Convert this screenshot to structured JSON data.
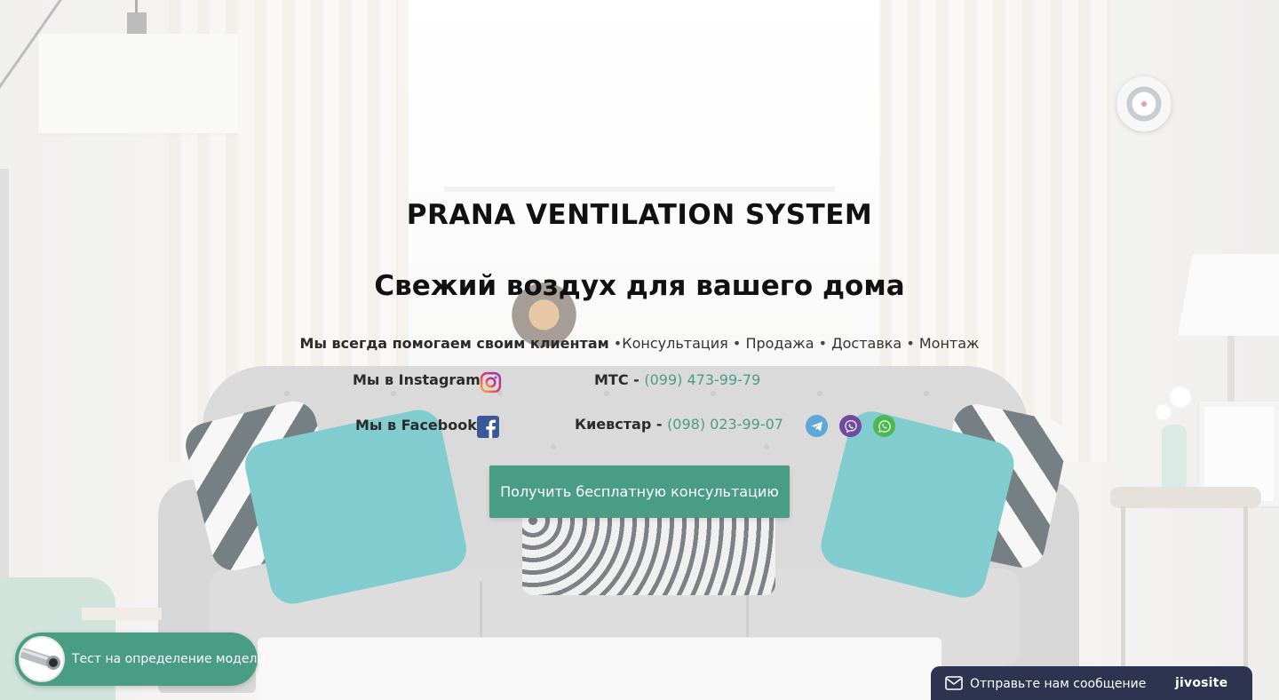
{
  "hero": {
    "title": "PRANA VENTILATION SYSTEM",
    "subtitle": "Свежий воздух для вашего дома"
  },
  "services": {
    "lead": "Мы всегда помогаем своим клиентам",
    "items": [
      "Консультация",
      "Продажа",
      "Доставка",
      "Монтаж"
    ],
    "separator": "•"
  },
  "social": {
    "instagram_label": "Мы в Instagram",
    "facebook_label": "Мы в Facebook"
  },
  "phones": {
    "mts": {
      "carrier": "МТС",
      "dash": " - ",
      "number": "(099) 473-99-79"
    },
    "kyivstar": {
      "carrier": "Киевстар",
      "dash": " - ",
      "number": "(098) 023-99-07"
    }
  },
  "messengers": [
    "telegram",
    "viber",
    "whatsapp"
  ],
  "cta": {
    "label": "Получить бесплатную консультацию"
  },
  "quiz": {
    "label": "Тест на определение модели"
  },
  "chat": {
    "label": "Отправьте нам сообщение",
    "brand": "jivosite"
  },
  "colors": {
    "accent": "#4a9d85",
    "chat_bar": "#2e3350",
    "telegram": "#5ea8d9",
    "viber": "#6f4a9e",
    "whatsapp": "#4cb84f",
    "facebook": "#3b5998"
  }
}
